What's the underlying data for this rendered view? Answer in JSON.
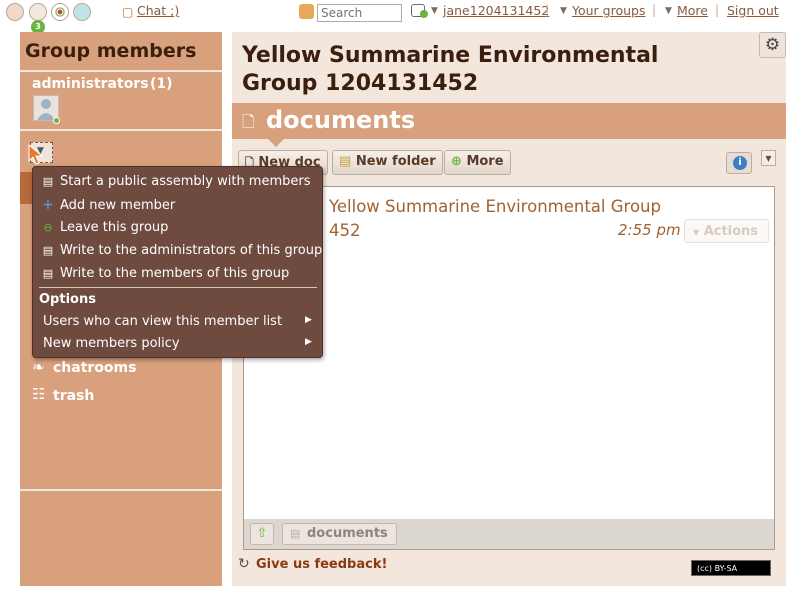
{
  "topbar": {
    "badge_count": "3",
    "chat_label": "Chat ;)",
    "search_placeholder": "Search",
    "username": "jane1204131452",
    "your_groups": "Your groups",
    "more": "More",
    "sign_out": "Sign out"
  },
  "sidebar": {
    "title": "Group members",
    "admins_label": "administrators",
    "admins_count": "(1)",
    "nav": [
      {
        "label": "chatrooms",
        "icon": "chatrooms-icon"
      },
      {
        "label": "trash",
        "icon": "trash-icon"
      }
    ]
  },
  "main": {
    "group_title": "Yellow Summarine Environmental Group 1204131452",
    "section_title": "documents",
    "toolbar": {
      "new_doc": "New doc",
      "new_folder": "New folder",
      "more": "More"
    },
    "doc": {
      "link_line1": "Yellow Summarine Environmental Group",
      "link_line2": "452",
      "time": "2:55 pm",
      "actions": "Actions"
    },
    "footer_crumb": "documents",
    "feedback": "Give us feedback!",
    "license": "(cc) BY-SA"
  },
  "menu": {
    "items": [
      {
        "label": "Start a public assembly with members",
        "icon": "assembly-icon"
      },
      {
        "label": "Add new member",
        "icon": "plus-icon"
      },
      {
        "label": "Leave this group",
        "icon": "minus-icon"
      },
      {
        "label": "Write to the administrators of this group",
        "icon": "document-icon"
      },
      {
        "label": "Write to the members of this group",
        "icon": "document-icon"
      }
    ],
    "options_label": "Options",
    "submenus": [
      {
        "label": "Users who can view this member list"
      },
      {
        "label": "New members policy"
      }
    ]
  },
  "colors": {
    "sidebar_bg": "#d9a07d",
    "main_bg": "#f3e6dc",
    "menu_bg": "#6e4a3f",
    "accent_link": "#a2622f"
  }
}
